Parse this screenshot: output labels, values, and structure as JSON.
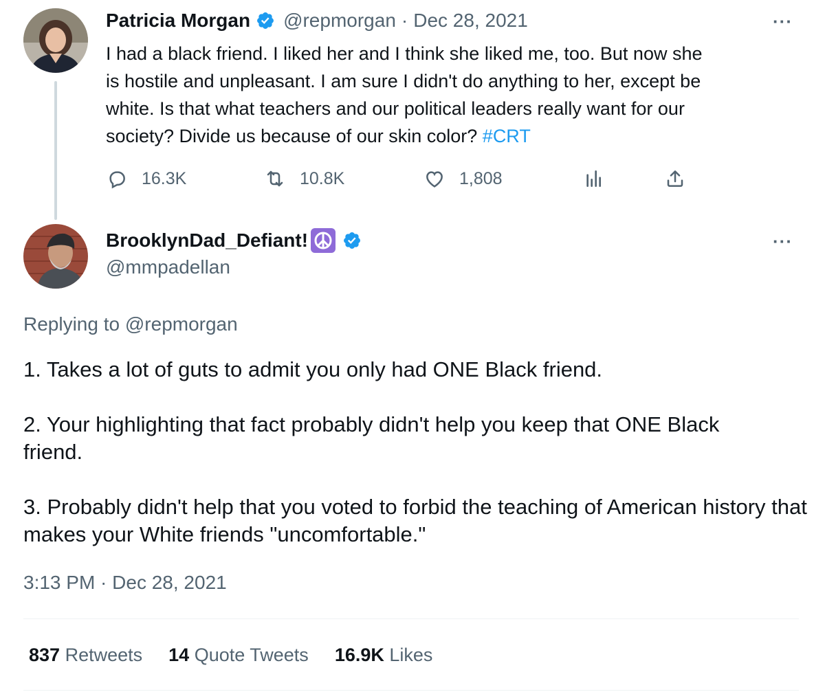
{
  "parent_tweet": {
    "author_name": "Patricia Morgan",
    "author_handle": "@repmorgan",
    "separator": "·",
    "date": "Dec 28, 2021",
    "text_lines": [
      "I had a black friend. I liked her and I think she liked me, too. But now she",
      "is hostile and unpleasant. I am sure I didn't do anything to her, except be",
      "white. Is that what teachers and our political leaders really want for our",
      "society?  Divide us because of our skin color?"
    ],
    "hashtag": "#CRT",
    "more_label": "···",
    "actions": {
      "replies": "16.3K",
      "retweets": "10.8K",
      "likes": "1,808"
    },
    "icons": [
      "reply-icon",
      "retweet-icon",
      "like-icon",
      "analytics-icon",
      "share-icon"
    ]
  },
  "reply_tweet": {
    "author_name": "BrooklynDad_Defiant!",
    "author_emoji": "☮",
    "author_handle": "@mmpadellan",
    "more_label": "···",
    "replying_to_label": "Replying to",
    "replying_to_handle": "@repmorgan",
    "paragraphs": [
      "1. Takes a lot of guts to admit you only had ONE Black friend.",
      "2. Your highlighting that fact probably didn't help you keep that ONE Black friend.",
      "3. Probably didn't help that you voted to forbid the teaching of American history that makes your White friends \"uncomfortable.\""
    ],
    "timestamp": "3:13 PM · Dec 28, 2021",
    "stats": {
      "retweets_count": "837",
      "retweets_label": "Retweets",
      "quotes_count": "14",
      "quotes_label": "Quote Tweets",
      "likes_count": "16.9K",
      "likes_label": "Likes"
    }
  },
  "colors": {
    "text": "#0f1419",
    "secondary": "#536471",
    "link": "#1d9bf0",
    "verified": "#1d9bf0",
    "divider": "#eff3f4",
    "emoji_bg": "#8e6bd8"
  }
}
